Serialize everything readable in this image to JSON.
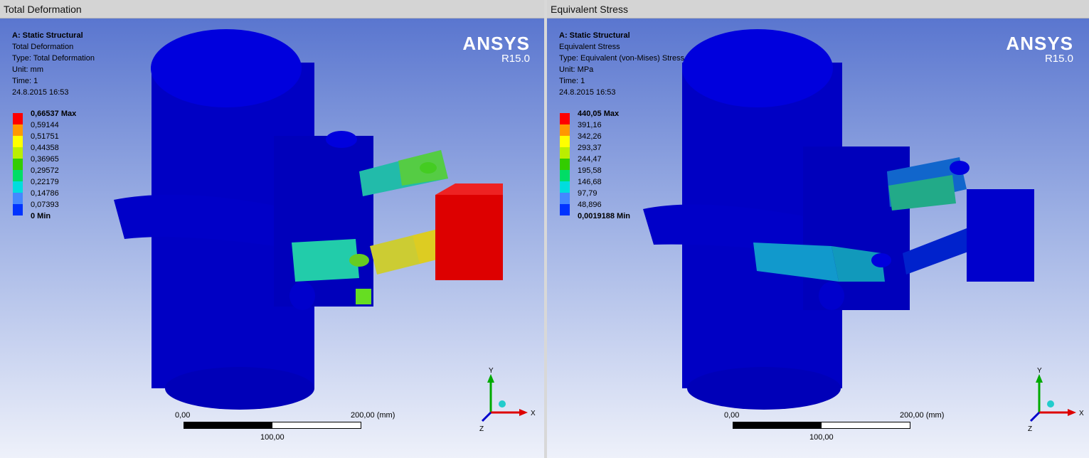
{
  "left": {
    "title": "Total Deformation",
    "info": {
      "analysis": "A: Static Structural",
      "result": "Total Deformation",
      "type": "Type: Total Deformation",
      "unit": "Unit: mm",
      "time": "Time: 1",
      "date": "24.8.2015 16:53"
    },
    "legend": [
      "0,66537 Max",
      "0,59144",
      "0,51751",
      "0,44358",
      "0,36965",
      "0,29572",
      "0,22179",
      "0,14786",
      "0,07393",
      "0 Min"
    ],
    "scale": {
      "start": "0,00",
      "end": "200,00 (mm)",
      "mid": "100,00"
    },
    "triad": {
      "y": "Y",
      "x": "X",
      "z": "Z"
    }
  },
  "right": {
    "title": "Equivalent Stress",
    "info": {
      "analysis": "A: Static Structural",
      "result": "Equivalent Stress",
      "type": "Type: Equivalent (von-Mises) Stress",
      "unit": "Unit: MPa",
      "time": "Time: 1",
      "date": "24.8.2015 16:53"
    },
    "legend": [
      "440,05 Max",
      "391,16",
      "342,26",
      "293,37",
      "244,47",
      "195,58",
      "146,68",
      "97,79",
      "48,896",
      "0,0019188 Min"
    ],
    "scale": {
      "start": "0,00",
      "end": "200,00 (mm)",
      "mid": "100,00"
    },
    "triad": {
      "y": "Y",
      "x": "X",
      "z": "Z"
    }
  },
  "brand": {
    "name": "ANSYS",
    "version": "R15.0"
  },
  "legend_colors": [
    "#ff0000",
    "#ff9900",
    "#ffff00",
    "#bbee00",
    "#33cc00",
    "#00dd66",
    "#00dddd",
    "#4488ff",
    "#0033ff",
    "#0000cc"
  ]
}
